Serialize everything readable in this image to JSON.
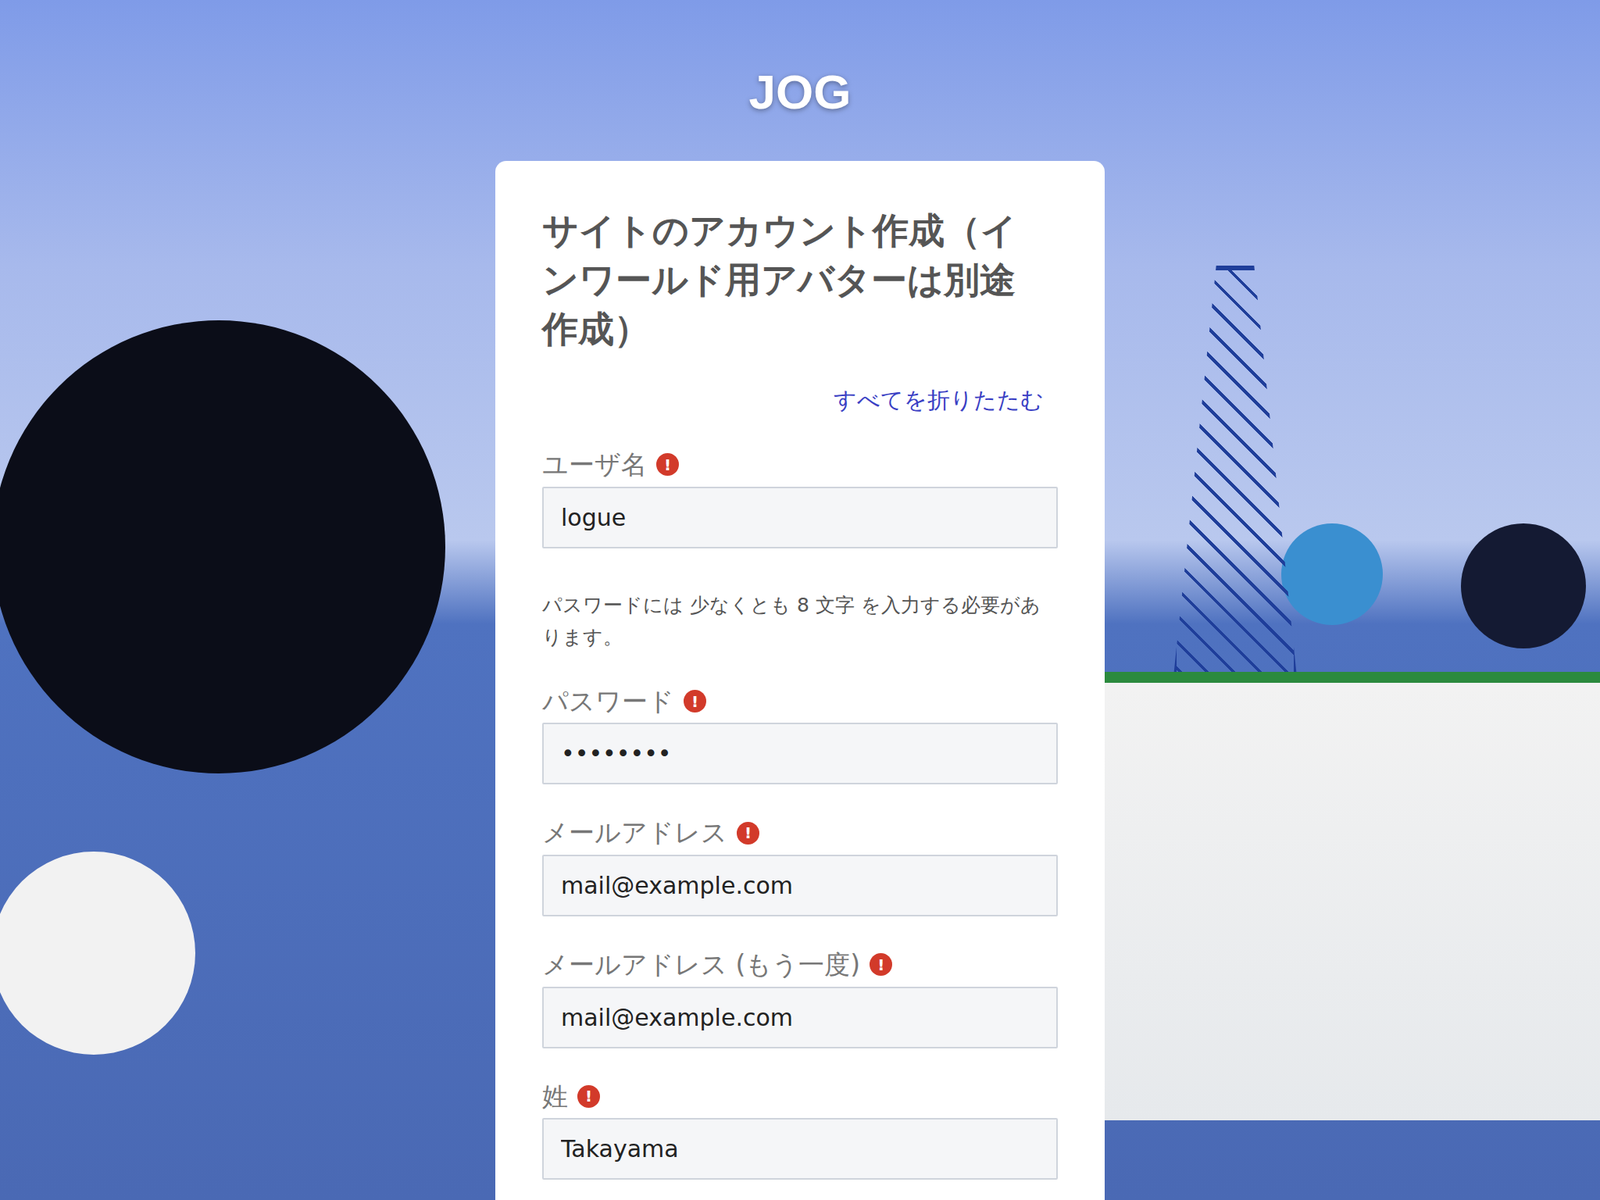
{
  "site": {
    "title": "JOG"
  },
  "form": {
    "title": "サイトのアカウント作成（インワールド用アバターは別途作成）",
    "collapse_link": "すべてを折りたたむ",
    "required_mark": "!",
    "items": [
      {
        "kind": "field",
        "label": "ユーザ名",
        "required": true,
        "value": "logue"
      },
      {
        "kind": "help",
        "text": "パスワードには 少なくとも 8 文字 を入力する必要があります。"
      },
      {
        "kind": "field",
        "label": "パスワード",
        "required": true,
        "value": "••••••••"
      },
      {
        "kind": "field",
        "label": "メールアドレス",
        "required": true,
        "value": "mail@example.com"
      },
      {
        "kind": "field",
        "label": "メールアドレス (もう一度)",
        "required": true,
        "value": "mail@example.com"
      },
      {
        "kind": "field",
        "label": "姓",
        "required": true,
        "value": "Takayama"
      }
    ]
  }
}
